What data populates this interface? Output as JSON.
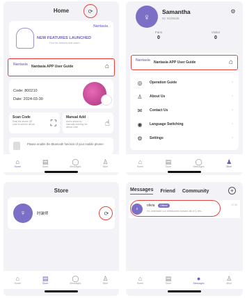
{
  "home": {
    "title": "Home",
    "banner_brand": "Nantasia",
    "banner_text": "NEW FEATURES LAUNCHED",
    "banner_sub": "Find the features that match",
    "guide_logo": "Nantasia",
    "guide_label": "Nantasia APP User Guide",
    "code": "Code: 800210",
    "date": "Date: 2024-03-30",
    "scan_title": "Scan Code",
    "scan_desc": "Scan the device QR code to add the device",
    "manual_title": "Manual Add",
    "manual_desc": "Add a device by manually entering the device code",
    "notice": "Please enable the Bluetooth function of your mobile phone!"
  },
  "profile": {
    "name": "Samantha",
    "id": "ID: 9235536",
    "fans_label": "Fans",
    "fans_value": "0",
    "visitor_label": "Visitor",
    "visitor_value": "0",
    "guide_logo": "Nantasia",
    "guide_label": "Nantasia APP User Guide",
    "menu": [
      {
        "label": "Operation Guide"
      },
      {
        "label": "About Us"
      },
      {
        "label": "Contact Us"
      },
      {
        "label": "Language Switching"
      },
      {
        "label": "Settings"
      }
    ]
  },
  "store": {
    "title": "Store",
    "name": "时装师"
  },
  "messages": {
    "tabs": [
      "Messages",
      "Friend",
      "Community"
    ],
    "plus": "+",
    "row_name": "olivia",
    "row_badge": "Official",
    "row_preview": "Hi, celebrate our milestones toward all of 1 res...",
    "row_time": "12:46"
  },
  "tabbar": {
    "labels": [
      "Home",
      "Store",
      "Messages",
      "Mine"
    ]
  },
  "colors": {
    "accent": "#6b5fb5",
    "highlight": "#e0463f"
  }
}
